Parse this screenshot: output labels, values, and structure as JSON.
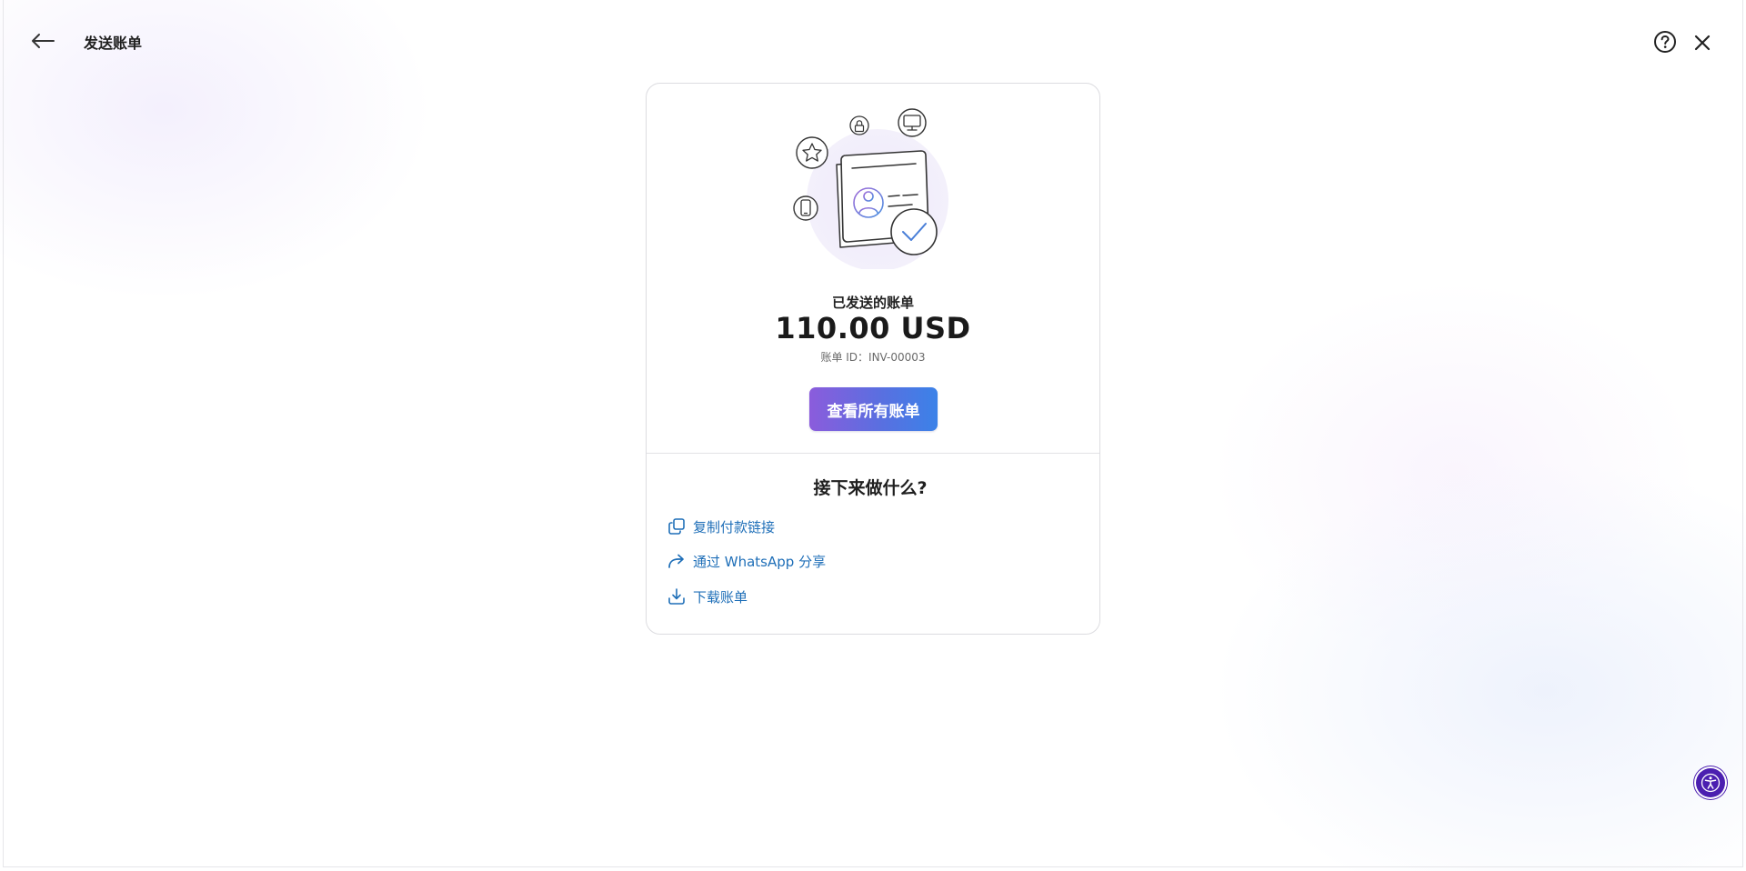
{
  "header": {
    "title": "发送账单",
    "back_icon": "arrow-left-icon",
    "help_icon": "help-circle-icon",
    "close_icon": "close-icon"
  },
  "card": {
    "status_label": "已发送的账单",
    "amount": "110.00 USD",
    "invoice_id": "账单 ID：INV-00003",
    "view_all_button": "查看所有账单",
    "next_title": "接下来做什么?",
    "actions": [
      {
        "label": "复制付款链接",
        "icon": "copy-icon"
      },
      {
        "label": "通过 WhatsApp 分享",
        "icon": "share-icon"
      },
      {
        "label": "下载账单",
        "icon": "download-icon"
      }
    ]
  },
  "colors": {
    "link": "#1f6fb8",
    "button_gradient_start": "#8b5cdc",
    "button_gradient_end": "#3b82e8",
    "accessibility": "#4b1fb0"
  },
  "accessibility_button": {
    "icon": "accessibility-icon"
  }
}
